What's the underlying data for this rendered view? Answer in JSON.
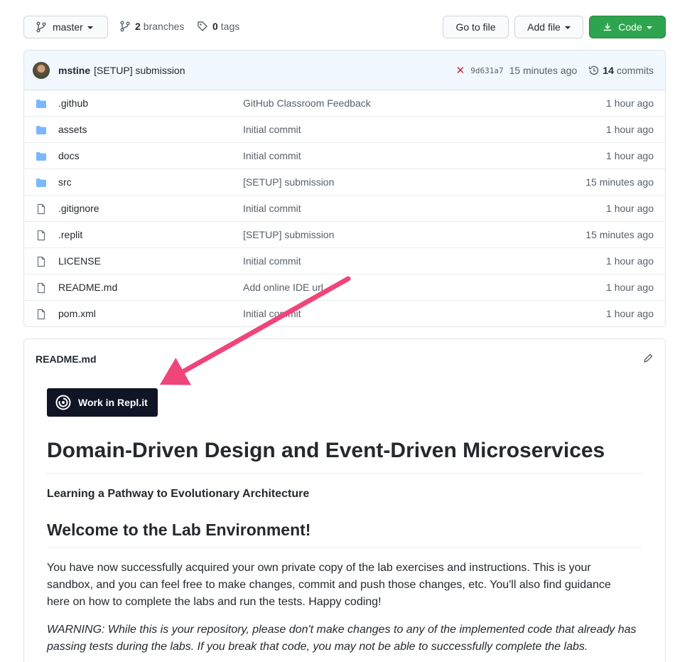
{
  "toolbar": {
    "branch_label": "master",
    "branches_count": "2",
    "branches_label": "branches",
    "tags_count": "0",
    "tags_label": "tags",
    "goto_file_label": "Go to file",
    "add_file_label": "Add file",
    "code_label": "Code"
  },
  "commit": {
    "author": "mstine",
    "message": "[SETUP] submission",
    "status_icon": "x-icon",
    "sha": "9d631a7",
    "time": "15 minutes ago",
    "commits_count": "14",
    "commits_label": "commits"
  },
  "files": [
    {
      "name": ".github",
      "type": "folder",
      "message": "GitHub Classroom Feedback",
      "age": "1 hour ago"
    },
    {
      "name": "assets",
      "type": "folder",
      "message": "Initial commit",
      "age": "1 hour ago"
    },
    {
      "name": "docs",
      "type": "folder",
      "message": "Initial commit",
      "age": "1 hour ago"
    },
    {
      "name": "src",
      "type": "folder",
      "message": "[SETUP] submission",
      "age": "15 minutes ago"
    },
    {
      "name": ".gitignore",
      "type": "file",
      "message": "Initial commit",
      "age": "1 hour ago"
    },
    {
      "name": ".replit",
      "type": "file",
      "message": "[SETUP] submission",
      "age": "15 minutes ago"
    },
    {
      "name": "LICENSE",
      "type": "file",
      "message": "Initial commit",
      "age": "1 hour ago"
    },
    {
      "name": "README.md",
      "type": "file",
      "message": "Add online IDE url",
      "age": "1 hour ago"
    },
    {
      "name": "pom.xml",
      "type": "file",
      "message": "Initial commit",
      "age": "1 hour ago"
    }
  ],
  "readme": {
    "filename": "README.md",
    "badge_label": "Work in Repl.it",
    "title": "Domain-Driven Design and Event-Driven Microservices",
    "subtitle": "Learning a Pathway to Evolutionary Architecture",
    "section_heading": "Welcome to the Lab Environment!",
    "paragraph_1": "You have now successfully acquired your own private copy of the lab exercises and instructions. This is your sandbox, and you can feel free to make changes, commit and push those changes, etc. You'll also find guidance here on how to complete the labs and run the tests. Happy coding!",
    "paragraph_2": "WARNING: While this is your repository, please don't make changes to any of the implemented code that already has passing tests during the labs. If you break that code, you may not be able to successfully complete the labs."
  },
  "colors": {
    "accent_green": "#2ea44f",
    "arrow_pink": "#f0457a",
    "commit_bar": "#f1f8ff",
    "folder_blue": "#79b8ff",
    "fail_red": "#cb2431"
  }
}
